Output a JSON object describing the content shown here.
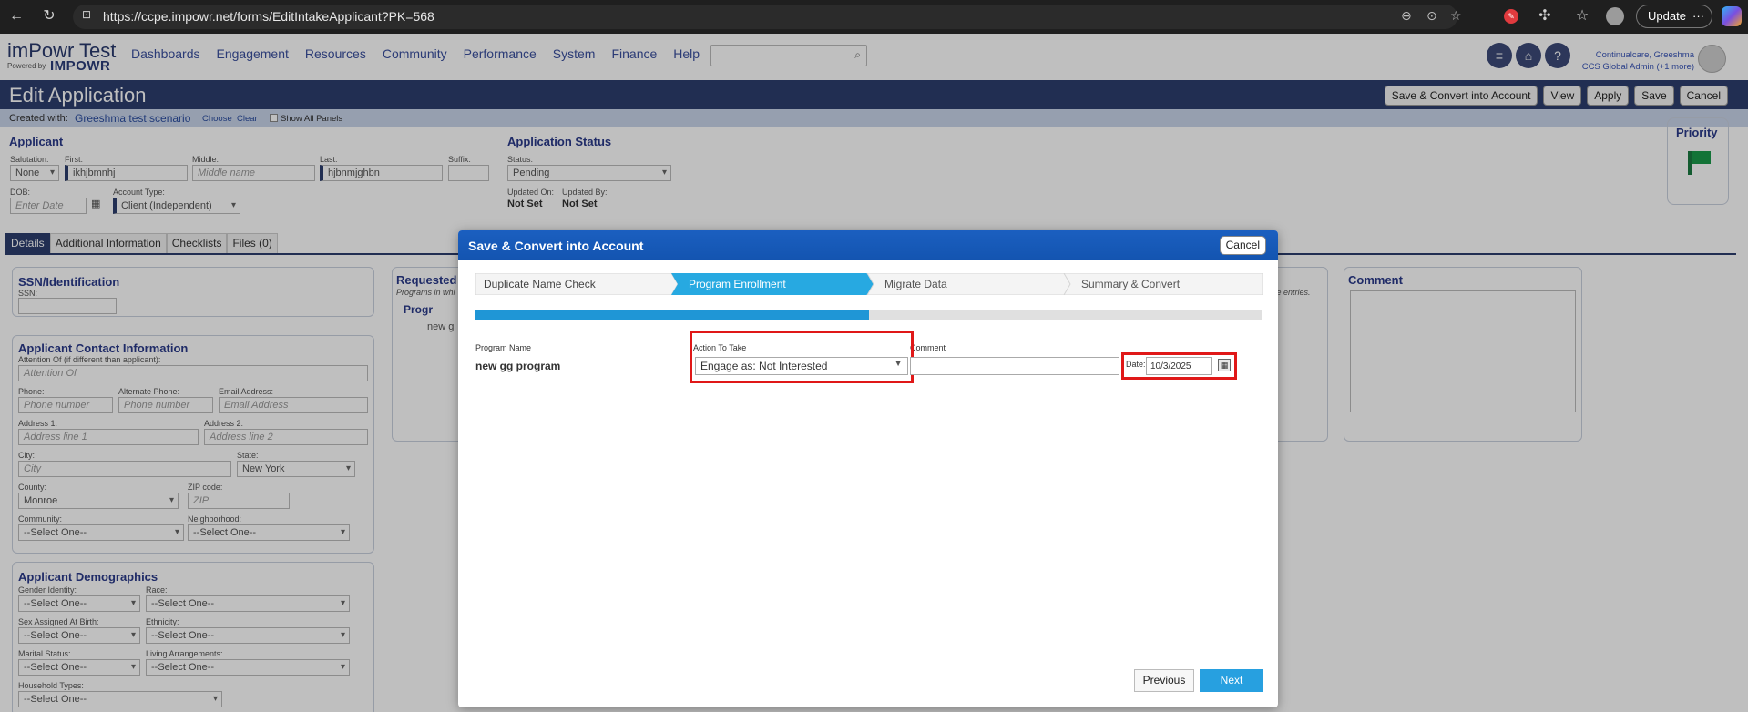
{
  "browser": {
    "url": "https://ccpe.impowr.net/forms/EditIntakeApplicant?PK=568",
    "update_label": "Update",
    "more": "···"
  },
  "header": {
    "logo_title": "imPowr Test",
    "logo_powered": "Powered by",
    "logo_brand": "IMPOWR",
    "nav": [
      "Dashboards",
      "Engagement",
      "Resources",
      "Community",
      "Performance",
      "System",
      "Finance",
      "Help"
    ],
    "user_line1": "Continualcare, Greeshma",
    "user_line2": "CCS Global Admin (+1 more)"
  },
  "page": {
    "title": "Edit Application",
    "buttons": [
      "Save & Convert into Account",
      "View",
      "Apply",
      "Save",
      "Cancel"
    ],
    "created_with_label": "Created with:",
    "created_with_value": "Greeshma test scenario",
    "choose": "Choose",
    "clear": "Clear",
    "show_all_panels": "Show All Panels"
  },
  "applicant": {
    "title": "Applicant",
    "salutation_label": "Salutation:",
    "salutation_value": "None",
    "first_label": "First:",
    "first_value": "ikhjbmnhj",
    "middle_label": "Middle:",
    "middle_placeholder": "Middle name",
    "last_label": "Last:",
    "last_value": "hjbnmjghbn",
    "suffix_label": "Suffix:",
    "dob_label": "DOB:",
    "dob_placeholder": "Enter Date",
    "account_type_label": "Account Type:",
    "account_type_value": "Client (Independent)"
  },
  "status": {
    "title": "Application Status",
    "status_label": "Status:",
    "status_value": "Pending",
    "updated_on_label": "Updated On:",
    "updated_on_value": "Not Set",
    "updated_by_label": "Updated By:",
    "updated_by_value": "Not Set"
  },
  "priority": {
    "title": "Priority"
  },
  "tabs": [
    "Details",
    "Additional Information",
    "Checklists",
    "Files (0)"
  ],
  "ssn": {
    "title": "SSN/Identification",
    "label": "SSN:"
  },
  "contact": {
    "title": "Applicant Contact Information",
    "attention_label": "Attention Of (if different than applicant):",
    "attention_placeholder": "Attention Of",
    "phone_label": "Phone:",
    "phone_placeholder": "Phone number",
    "alt_phone_label": "Alternate Phone:",
    "alt_phone_placeholder": "Phone number",
    "email_label": "Email Address:",
    "email_placeholder": "Email Address",
    "addr1_label": "Address 1:",
    "addr1_placeholder": "Address line 1",
    "addr2_label": "Address 2:",
    "addr2_placeholder": "Address line 2",
    "city_label": "City:",
    "city_placeholder": "City",
    "state_label": "State:",
    "state_value": "New York",
    "county_label": "County:",
    "county_value": "Monroe",
    "zip_label": "ZIP code:",
    "zip_placeholder": "ZIP",
    "community_label": "Community:",
    "community_value": "--Select One--",
    "neighborhood_label": "Neighborhood:",
    "neighborhood_value": "--Select One--"
  },
  "demographics": {
    "title": "Applicant Demographics",
    "gender_label": "Gender Identity:",
    "race_label": "Race:",
    "sex_label": "Sex Assigned At Birth:",
    "ethnicity_label": "Ethnicity:",
    "marital_label": "Marital Status:",
    "living_label": "Living Arrangements:",
    "household_label": "Household Types:",
    "select_one": "--Select One--"
  },
  "requested": {
    "title": "Requested",
    "subtitle": "Programs in whi",
    "col": "Progr",
    "row": "new g",
    "right_note": "ve entries."
  },
  "comment": {
    "title": "Comment"
  },
  "modal": {
    "title": "Save & Convert into Account",
    "cancel": "Cancel",
    "steps": [
      "Duplicate Name Check",
      "Program Enrollment",
      "Migrate Data",
      "Summary & Convert"
    ],
    "active_step": 1,
    "progress_fraction": 0.5,
    "col_program": "Program Name",
    "col_action": "Action To Take",
    "col_comment": "Comment",
    "program_name": "new gg program",
    "action_value": "Engage as: Not Interested",
    "date_label": "Date:",
    "date_value": "10/3/2025",
    "previous": "Previous",
    "next": "Next",
    "highlight_color": "#e01818",
    "accent_color": "#27a9e1"
  }
}
